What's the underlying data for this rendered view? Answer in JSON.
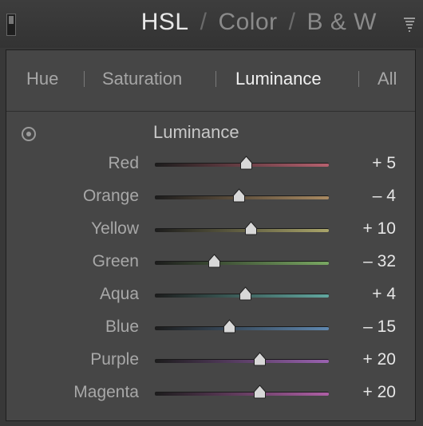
{
  "header": {
    "tabs": [
      "HSL",
      "Color",
      "B & W"
    ],
    "active_tab": "HSL",
    "separator": "/"
  },
  "subtabs": {
    "items": [
      "Hue",
      "Saturation",
      "Luminance",
      "All"
    ],
    "active": "Luminance"
  },
  "section": {
    "title": "Luminance"
  },
  "sliders": [
    {
      "label": "Red",
      "value_text": "+ 5",
      "value": 5,
      "color": "#b5606e"
    },
    {
      "label": "Orange",
      "value_text": "– 4",
      "value": -4,
      "color": "#a98a62"
    },
    {
      "label": "Yellow",
      "value_text": "+ 10",
      "value": 10,
      "color": "#aaa56a"
    },
    {
      "label": "Green",
      "value_text": "– 32",
      "value": -32,
      "color": "#79a862"
    },
    {
      "label": "Aqua",
      "value_text": "+ 4",
      "value": 4,
      "color": "#62a8a0"
    },
    {
      "label": "Blue",
      "value_text": "– 15",
      "value": -15,
      "color": "#5f88b0"
    },
    {
      "label": "Purple",
      "value_text": "+ 20",
      "value": 20,
      "color": "#9a62b0"
    },
    {
      "label": "Magenta",
      "value_text": "+ 20",
      "value": 20,
      "color": "#ae5fa5"
    }
  ],
  "slider_range": [
    -100,
    100
  ],
  "icons": {
    "collapse": "panel-collapse-icon",
    "menu": "panel-menu-icon",
    "target": "targeted-adjustment-icon"
  }
}
